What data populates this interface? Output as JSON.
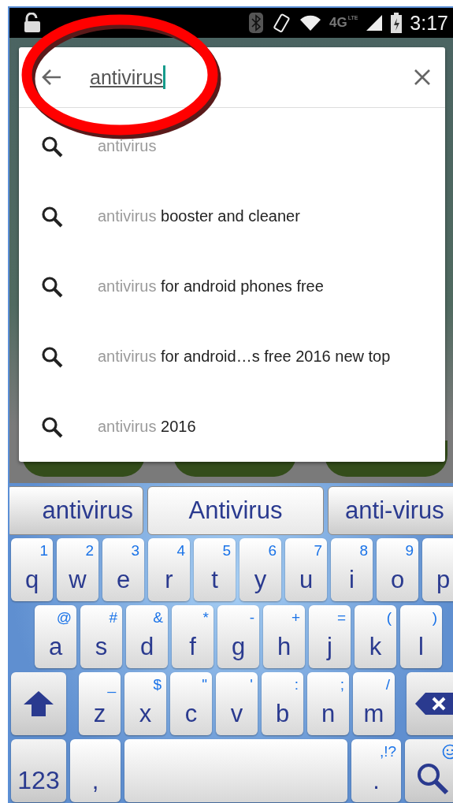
{
  "status_bar": {
    "network": "4G",
    "network_sub": "LTE",
    "time": "3:17"
  },
  "search": {
    "value": "antivirus"
  },
  "suggestions": [
    {
      "prefix": "antivirus"
    },
    {
      "prefix": "antivirus",
      "rest": " booster and cleaner"
    },
    {
      "prefix": "antivirus",
      "rest": " for android phones free"
    },
    {
      "prefix": "antivirus",
      "rest": " for android…s free 2016 new top"
    },
    {
      "prefix": "antivirus",
      "rest": " 2016"
    }
  ],
  "word_suggestions": [
    {
      "label": "antivirus",
      "selected": false
    },
    {
      "label": "Antivirus",
      "selected": true
    },
    {
      "label": "anti-virus",
      "selected": false
    }
  ],
  "keyboard": {
    "rows": [
      {
        "keys": [
          {
            "kind": "letter",
            "label": "q",
            "alt": "1"
          },
          {
            "kind": "letter",
            "label": "w",
            "alt": "2"
          },
          {
            "kind": "letter",
            "label": "e",
            "alt": "3"
          },
          {
            "kind": "letter",
            "label": "r",
            "alt": "4"
          },
          {
            "kind": "letter",
            "label": "t",
            "alt": "5"
          },
          {
            "kind": "letter",
            "label": "y",
            "alt": "6"
          },
          {
            "kind": "letter",
            "label": "u",
            "alt": "7"
          },
          {
            "kind": "letter",
            "label": "i",
            "alt": "8"
          },
          {
            "kind": "letter",
            "label": "o",
            "alt": "9"
          },
          {
            "kind": "letter",
            "label": "p"
          }
        ]
      },
      {
        "keys": [
          {
            "kind": "letter",
            "label": "a",
            "alt": "@"
          },
          {
            "kind": "letter",
            "label": "s",
            "alt": "#"
          },
          {
            "kind": "letter",
            "label": "d",
            "alt": "&"
          },
          {
            "kind": "letter",
            "label": "f",
            "alt": "*"
          },
          {
            "kind": "letter",
            "label": "g",
            "alt": "-"
          },
          {
            "kind": "letter",
            "label": "h",
            "alt": "+"
          },
          {
            "kind": "letter",
            "label": "j",
            "alt": "="
          },
          {
            "kind": "letter",
            "label": "k",
            "alt": "("
          },
          {
            "kind": "letter",
            "label": "l",
            "alt": ")"
          }
        ]
      },
      {
        "keys": [
          {
            "kind": "shift"
          },
          {
            "kind": "letter",
            "label": "z",
            "alt": "_"
          },
          {
            "kind": "letter",
            "label": "x",
            "alt": "$"
          },
          {
            "kind": "letter",
            "label": "c",
            "alt": "\""
          },
          {
            "kind": "letter",
            "label": "v",
            "alt": "'"
          },
          {
            "kind": "letter",
            "label": "b",
            "alt": ":"
          },
          {
            "kind": "letter",
            "label": "n",
            "alt": ";"
          },
          {
            "kind": "letter",
            "label": "m",
            "alt": "/"
          },
          {
            "kind": "backspace"
          }
        ]
      },
      {
        "keys": [
          {
            "kind": "mode",
            "label": "123"
          },
          {
            "kind": "letter",
            "label": ","
          },
          {
            "kind": "space"
          },
          {
            "kind": "letter",
            "label": ".",
            "alt": ",!?"
          },
          {
            "kind": "search"
          }
        ]
      }
    ]
  }
}
